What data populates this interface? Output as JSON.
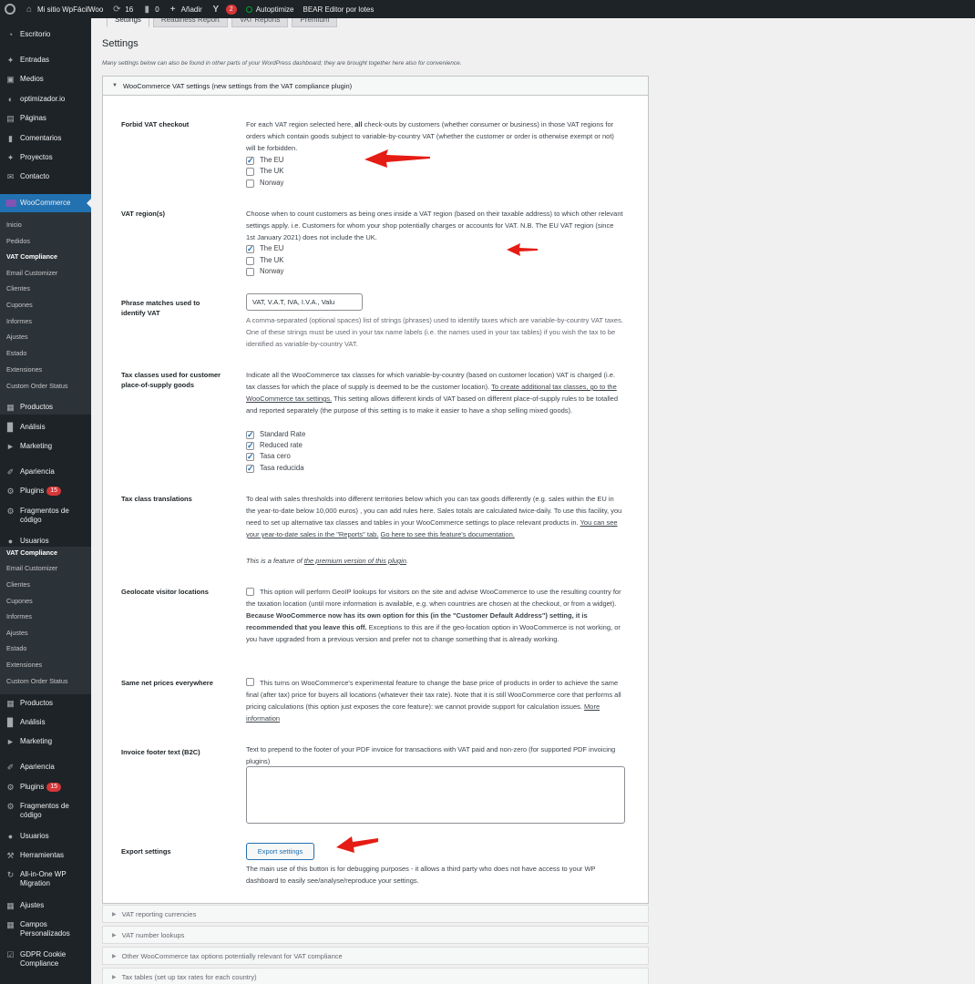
{
  "admin_bar": {
    "site_name": "Mi sitio WpFácilWoo",
    "updates_count": "16",
    "comments_count": "0",
    "new_label": "Añadir",
    "yoast_count": "2",
    "autoptimize_label": "Autoptimize",
    "bear_label": "BEAR Editor por lotes"
  },
  "sidebar": {
    "top_items": [
      "Escritorio",
      "Entradas",
      "Medios",
      "optimizador.io",
      "Páginas",
      "Comentarios",
      "Proyectos",
      "Contacto"
    ],
    "woocommerce_label": "WooCommerce",
    "woo_submenu": [
      "Inicio",
      "Pedidos",
      "VAT Compliance",
      "Email Customizer",
      "Clientes",
      "Cupones",
      "Informes",
      "Ajustes",
      "Estado",
      "Extensiones",
      "Custom Order Status"
    ],
    "mid_items": [
      "Productos",
      "Análisis",
      "Marketing",
      "Apariencia",
      "Plugins",
      "Fragmentos de código",
      "Usuarios"
    ],
    "plugins_badge": "15",
    "dup_submenu": [
      "VAT Compliance",
      "Email Customizer",
      "Clientes",
      "Cupones",
      "Informes",
      "Ajustes",
      "Estado",
      "Extensiones",
      "Custom Order Status"
    ],
    "bottom_items": [
      "Productos",
      "Análisis",
      "Marketing",
      "Apariencia",
      "Plugins",
      "Fragmentos de código",
      "Usuarios",
      "Herramientas",
      "All-in-One WP Migration",
      "Ajustes",
      "Campos Personalizados",
      "GDPR Cookie Compliance"
    ]
  },
  "tabs": [
    "Settings",
    "Readiness Report",
    "VAT Reports",
    "Premium"
  ],
  "page_title": "Settings",
  "intro": "Many settings below can also be found in other parts of your WordPress dashboard; they are brought together here also for convenience.",
  "panel": {
    "title": "WooCommerce VAT settings (new settings from the VAT compliance plugin)",
    "forbid": {
      "label": "Forbid VAT checkout",
      "text_a": "For each VAT region selected here, ",
      "text_bold": "all",
      "text_b": " check-outs by customers (whether consumer or business) in those VAT regions for orders which contain goods subject to variable-by-country VAT (whether the customer or order is otherwise exempt or not) will be forbidden.",
      "options": [
        "The EU",
        "The UK",
        "Norway"
      ]
    },
    "region": {
      "label": "VAT region(s)",
      "text": "Choose when to count customers as being ones inside a VAT region (based on their taxable address) to which other relevant settings apply. i.e. Customers for whom your shop potentially charges or accounts for VAT. N.B. The EU VAT region (since 1st January 2021) does not include the UK.",
      "options": [
        "The EU",
        "The UK",
        "Norway"
      ]
    },
    "phrase": {
      "label": "Phrase matches used to identify VAT",
      "value": "VAT, V.A.T, IVA, I.V.A., Valu",
      "desc": "A comma-separated (optional spaces) list of strings (phrases) used to identify taxes which are variable-by-country VAT taxes. One of these strings must be used in your tax name labels (i.e. the names used in your tax tables) if you wish the tax to be identified as variable-by-country VAT."
    },
    "taxclasses": {
      "label": "Tax classes used for customer place-of-supply goods",
      "text_a": "Indicate all the WooCommerce tax classes for which variable-by-country (based on customer location) VAT is charged (i.e. tax classes for which the place of supply is deemed to be the customer location). ",
      "link": "To create additional tax classes, go to the WooCommerce tax settings.",
      "text_b": " This setting allows different kinds of VAT based on different place-of-supply rules to be totalled and reported separately (the purpose of this setting is to make it easier to have a shop selling mixed goods).",
      "options": [
        "Standard Rate",
        "Reduced rate",
        "Tasa cero",
        "Tasa reducida"
      ]
    },
    "translations": {
      "label": "Tax class translations",
      "text_a": "To deal with sales thresholds into different territories below which you can tax goods differently (e.g. sales within the EU in the year-to-date below 10,000 euros) , you can add rules here. Sales totals are calculated twice-daily. To use this facility, you need to set up alternative tax classes and tables in your WooCommerce settings to place relevant products in. ",
      "link1": "You can see your year-to-date sales in the \"Reports\" tab.",
      "link2": "Go here to see this feature's documentation.",
      "premium_a": "This is a feature of ",
      "premium_link": "the premium version of this plugin",
      "premium_b": "."
    },
    "geolocate": {
      "label": "Geolocate visitor locations",
      "text_a": "This option will perform GeoIP lookups for visitors on the site and advise WooCommerce to use the resulting country for the taxation location (until more information is available, e.g. when countries are chosen at the checkout, or from a widget). ",
      "text_bold": "Because WooCommerce now has its own option for this (in the \"Customer Default Address\") setting, it is recommended that you leave this off.",
      "text_b": " Exceptions to this are if the geo-location option in WooCommerce is not working, or you have upgraded from a previous version and prefer not to change something that is already working."
    },
    "netprices": {
      "label": "Same net prices everywhere",
      "text": "This turns on WooCommerce's experimental feature to change the base price of products in order to achieve the same final (after tax) price for buyers all locations (whatever their tax rate). Note that it is still WooCommerce core that performs all pricing calculations (this option just exposes the core feature): we cannot provide support for calculation issues. ",
      "link": "More information"
    },
    "footer": {
      "label": "Invoice footer text (B2C)",
      "text": "Text to prepend to the footer of your PDF invoice for transactions with VAT paid and non-zero (for supported PDF invoicing plugins)"
    },
    "export": {
      "label": "Export settings",
      "button": "Export settings",
      "desc": "The main use of this button is for debugging purposes - it allows a third party who does not have access to your WP dashboard to easily see/analyse/reproduce your settings."
    }
  },
  "collapsed_sections": [
    "VAT reporting currencies",
    "VAT number lookups",
    "Other WooCommerce tax options potentially relevant for VAT compliance",
    "Tax tables (set up tax rates for each country)"
  ],
  "colors": {
    "accent": "#2271b1",
    "arrow": "#e51c14",
    "sidebar": "#1d2327",
    "badge": "#d63638"
  }
}
